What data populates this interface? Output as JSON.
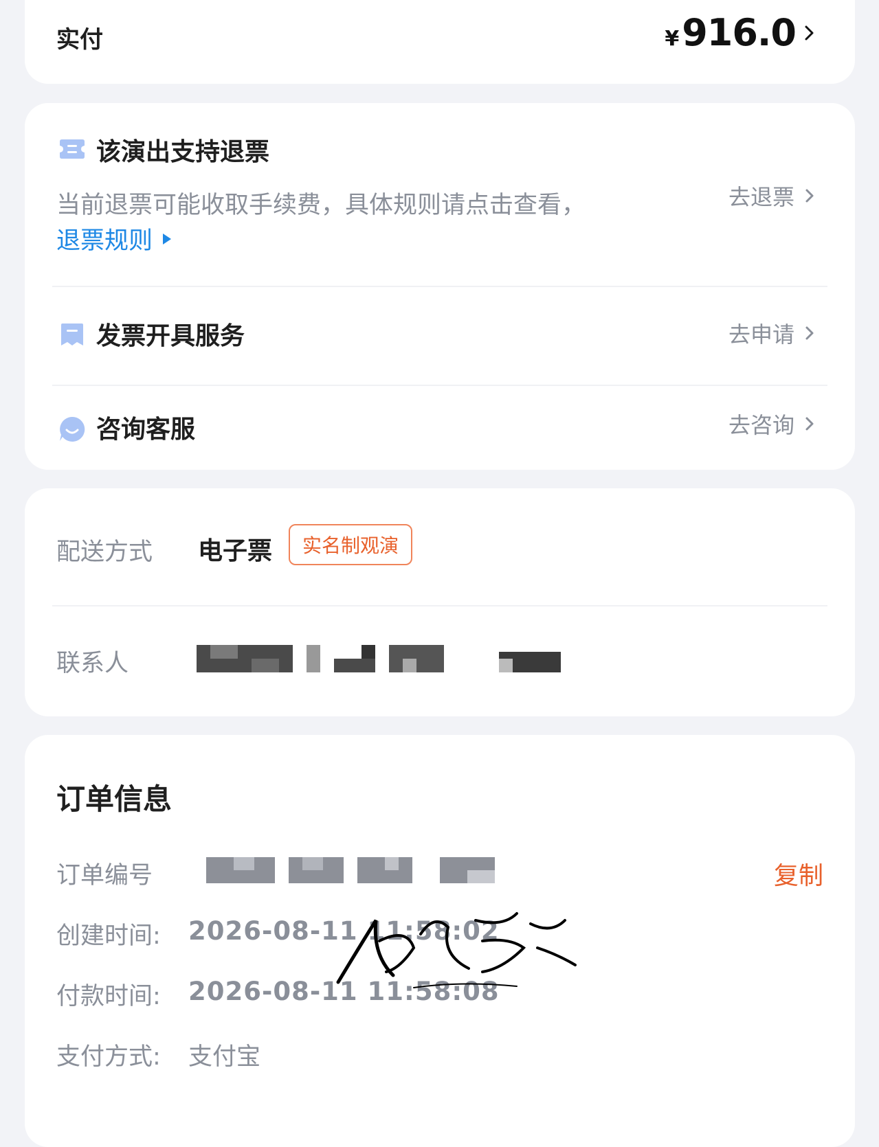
{
  "payment": {
    "label": "实付",
    "currency": "¥",
    "amount": "916.0"
  },
  "services": {
    "refund": {
      "title": "该演出支持退票",
      "description": "当前退票可能收取手续费，具体规则请点击查看，",
      "rules_link": "退票规则",
      "action": "去退票"
    },
    "invoice": {
      "title": "发票开具服务",
      "action": "去申请"
    },
    "support": {
      "title": "咨询客服",
      "action": "去咨询"
    },
    "icons": {
      "refund": "ticket-icon",
      "invoice": "invoice-icon",
      "support": "chat-icon"
    },
    "icon_color": "#a9c3f5"
  },
  "delivery": {
    "method_label": "配送方式",
    "method_value": "电子票",
    "badge": "实名制观演",
    "contact_label": "联系人"
  },
  "order": {
    "title": "订单信息",
    "number_label": "订单编号",
    "copy": "复制",
    "created_label": "创建时间:",
    "created_value": "2026-08-11 11:58:02",
    "paid_label": "付款时间:",
    "paid_value": "2026-08-11 11:58:08",
    "method_label": "支付方式:",
    "method_value": "支付宝"
  },
  "colors": {
    "accent_orange": "#e8612c",
    "link_blue": "#1e88e5",
    "muted_gray": "#8a8f99"
  }
}
